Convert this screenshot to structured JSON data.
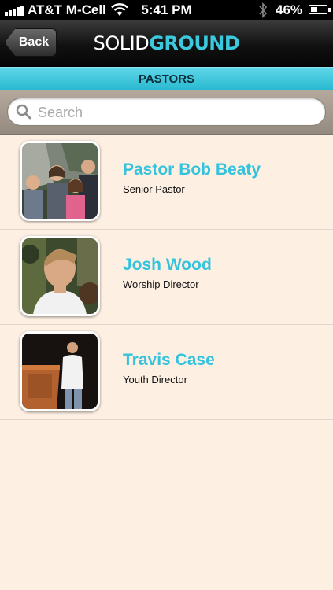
{
  "status_bar": {
    "carrier": "AT&T M-Cell",
    "time": "5:41 PM",
    "battery": "46%",
    "battery_level": 0.46
  },
  "nav": {
    "back_label": "Back",
    "logo_part1": "SOLID",
    "logo_part2": "GROUND"
  },
  "section": {
    "title": "PASTORS"
  },
  "search": {
    "placeholder": "Search"
  },
  "people": [
    {
      "name": "Pastor Bob Beaty",
      "role": "Senior Pastor"
    },
    {
      "name": "Josh Wood",
      "role": "Worship Director"
    },
    {
      "name": "Travis Case",
      "role": "Youth Director"
    }
  ],
  "colors": {
    "accent": "#34c3dd",
    "background": "#fdefe2",
    "header": "#27b8d0"
  }
}
